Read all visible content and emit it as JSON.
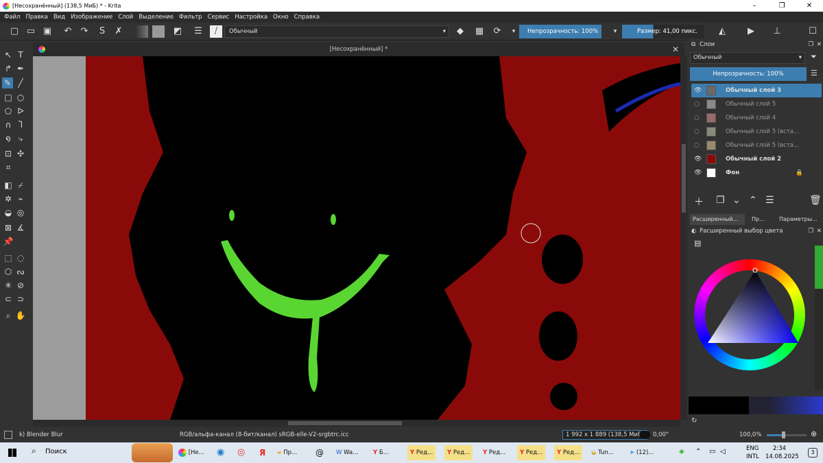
{
  "window": {
    "title": "[Несохранённый]  (138,5 МиБ)  * - Krita",
    "controls": [
      "–",
      "❐",
      "✕"
    ]
  },
  "menu": [
    "Файл",
    "Правка",
    "Вид",
    "Изображение",
    "Слой",
    "Выделение",
    "Фильтр",
    "Сервис",
    "Настройка",
    "Окно",
    "Справка"
  ],
  "toolbar": {
    "blend_mode": "Обычный",
    "opacity": "Непрозрачность: 100%",
    "size": "Размер: 41,00 пикс."
  },
  "document": {
    "tab_title": "[Несохранённый]  *"
  },
  "layers_panel": {
    "title": "Слои",
    "blend_mode": "Обычный",
    "opacity": "Непрозрачность:  100%",
    "layers": [
      {
        "name": "Обычный слой 3",
        "visible": true,
        "selected": true,
        "thumb": "#6a6a6a"
      },
      {
        "name": "Обычный слой 5",
        "visible": false,
        "selected": false,
        "thumb": "#8a8a8a"
      },
      {
        "name": "Обычный слой 4",
        "visible": false,
        "selected": false,
        "thumb": "#9a6a6a"
      },
      {
        "name": "Обычный слой 5 (вста...",
        "visible": false,
        "selected": false,
        "thumb": "#8a8a7a"
      },
      {
        "name": "Обычный слой 5 (вста...",
        "visible": false,
        "selected": false,
        "thumb": "#9a8a6a"
      },
      {
        "name": "Обычный слой 2",
        "visible": true,
        "selected": false,
        "thumb": "#8a0a0a"
      },
      {
        "name": "Фон",
        "visible": true,
        "selected": false,
        "thumb": "#ffffff"
      }
    ],
    "tabs": [
      "Расширенный...",
      "Пр...",
      "Параметры..."
    ]
  },
  "color_panel": {
    "title": "Расширенный выбор цвета"
  },
  "status": {
    "brush": "k) Blender Blur",
    "colorspace": "RGB/альфа-канал (8-бит/канал)  sRGB-elle-V2-srgbtrc.icc",
    "dimensions": "1 992 x 1 889 (138,5 МиБ)",
    "rotation": "0,00°",
    "zoom": "100,0%"
  },
  "taskbar": {
    "search": "Поиск",
    "items": [
      "[Не...",
      "Пр...",
      "Wa...",
      "Б...",
      "Ред...",
      "Ред...",
      "Ред...",
      "Ред...",
      "Ред...",
      "Tun...",
      "(12)..."
    ],
    "lang": "ENG",
    "lang2": "INTL",
    "time": "2:34",
    "date": "14.08.2025",
    "notif": "3"
  }
}
